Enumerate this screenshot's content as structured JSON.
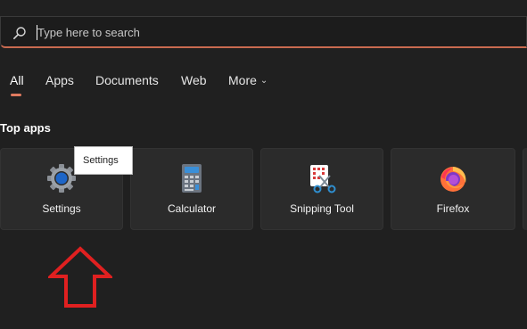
{
  "search": {
    "placeholder": "Type here to search",
    "icon": "search-icon"
  },
  "tabs": [
    {
      "label": "All",
      "active": true
    },
    {
      "label": "Apps",
      "active": false
    },
    {
      "label": "Documents",
      "active": false
    },
    {
      "label": "Web",
      "active": false
    },
    {
      "label": "More",
      "active": false,
      "icon": "chevron-down-icon"
    }
  ],
  "section": {
    "title": "Top apps"
  },
  "apps": [
    {
      "label": "Settings",
      "icon": "settings-gear-icon"
    },
    {
      "label": "Calculator",
      "icon": "calculator-icon"
    },
    {
      "label": "Snipping Tool",
      "icon": "snipping-tool-icon"
    },
    {
      "label": "Firefox",
      "icon": "firefox-icon"
    }
  ],
  "tooltip": {
    "text": "Settings"
  },
  "annotation": {
    "icon": "red-up-arrow-icon",
    "color": "#e02020"
  },
  "colors": {
    "background": "#202020",
    "tile": "#2b2b2b",
    "accent": "#e07a5f"
  }
}
